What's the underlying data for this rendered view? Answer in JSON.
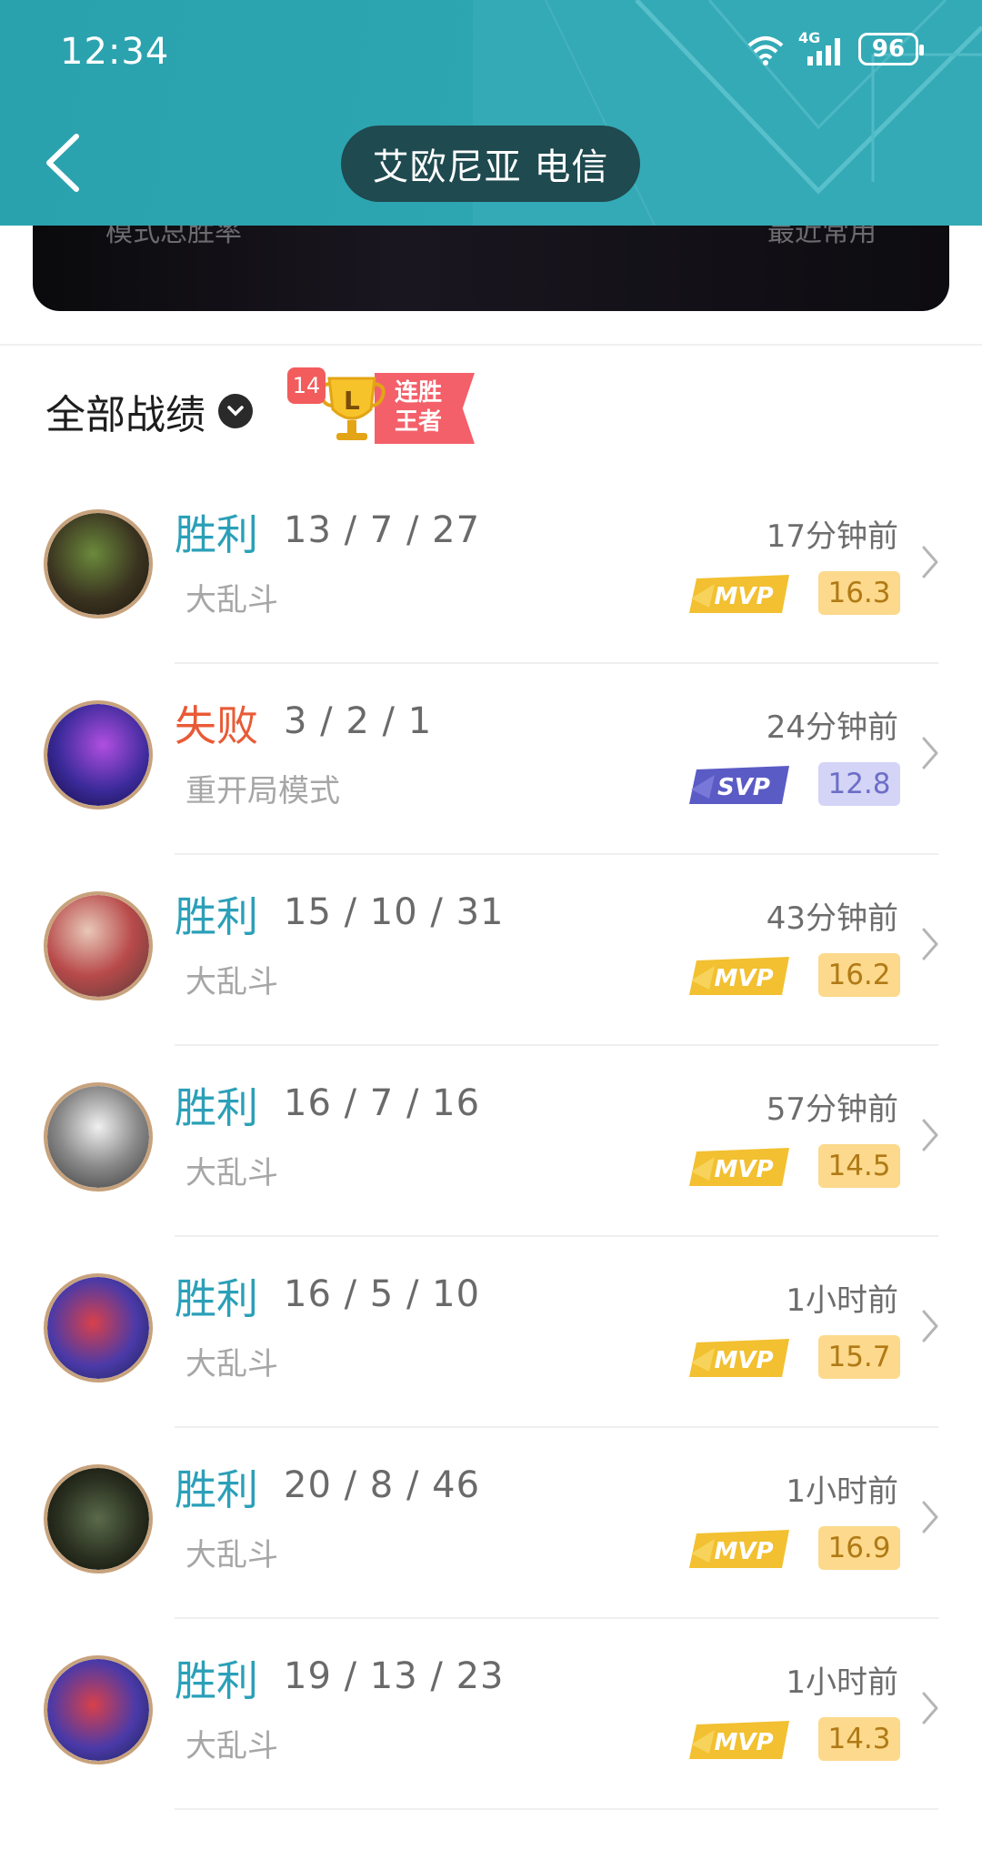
{
  "status_bar": {
    "time": "12:34",
    "network": "4G",
    "battery": "96"
  },
  "header": {
    "title": "艾欧尼亚 电信"
  },
  "banner": {
    "left_text": "模式总胜率",
    "right_text": "最近常用"
  },
  "filter": {
    "label": "全部战绩"
  },
  "streak_badge": {
    "count": "14",
    "letter": "L",
    "text_line1": "连胜",
    "text_line2": "王者"
  },
  "colors": {
    "header": "#2ea6b2",
    "win": "#2ba0b8",
    "lose": "#e95a36",
    "mvp_score_bg": "#fcd98c",
    "svp_score_bg": "#d4d4f7"
  },
  "matches": [
    {
      "result": "胜利",
      "kda": "13 / 7 / 27",
      "mode": "大乱斗",
      "time": "17分钟前",
      "badge": "MVP",
      "score": "16.3",
      "avatar": "champion-avatar"
    },
    {
      "result": "失败",
      "kda": "3 / 2 / 1",
      "mode": "重开局模式",
      "time": "24分钟前",
      "badge": "SVP",
      "score": "12.8",
      "avatar": "champion-avatar"
    },
    {
      "result": "胜利",
      "kda": "15 / 10 / 31",
      "mode": "大乱斗",
      "time": "43分钟前",
      "badge": "MVP",
      "score": "16.2",
      "avatar": "champion-avatar"
    },
    {
      "result": "胜利",
      "kda": "16 / 7 / 16",
      "mode": "大乱斗",
      "time": "57分钟前",
      "badge": "MVP",
      "score": "14.5",
      "avatar": "champion-avatar"
    },
    {
      "result": "胜利",
      "kda": "16 / 5 / 10",
      "mode": "大乱斗",
      "time": "1小时前",
      "badge": "MVP",
      "score": "15.7",
      "avatar": "champion-avatar"
    },
    {
      "result": "胜利",
      "kda": "20 / 8 / 46",
      "mode": "大乱斗",
      "time": "1小时前",
      "badge": "MVP",
      "score": "16.9",
      "avatar": "champion-avatar"
    },
    {
      "result": "胜利",
      "kda": "19 / 13 / 23",
      "mode": "大乱斗",
      "time": "1小时前",
      "badge": "MVP",
      "score": "14.3",
      "avatar": "champion-avatar"
    }
  ]
}
